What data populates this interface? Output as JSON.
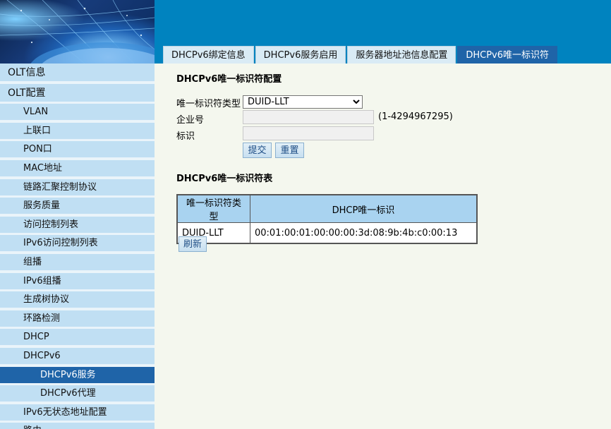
{
  "tabs": [
    {
      "label": "DHCPv6绑定信息",
      "active": false
    },
    {
      "label": "DHCPv6服务启用",
      "active": false
    },
    {
      "label": "服务器地址池信息配置",
      "active": false
    },
    {
      "label": "DHCPv6唯一标识符",
      "active": true
    }
  ],
  "sidebar": {
    "items": [
      {
        "label": "OLT信息",
        "level": 1
      },
      {
        "label": "OLT配置",
        "level": 1
      },
      {
        "label": "VLAN",
        "level": 2
      },
      {
        "label": "上联口",
        "level": 2
      },
      {
        "label": "PON口",
        "level": 2
      },
      {
        "label": "MAC地址",
        "level": 2
      },
      {
        "label": "链路汇聚控制协议",
        "level": 2
      },
      {
        "label": "服务质量",
        "level": 2
      },
      {
        "label": "访问控制列表",
        "level": 2
      },
      {
        "label": "IPv6访问控制列表",
        "level": 2
      },
      {
        "label": "组播",
        "level": 2
      },
      {
        "label": "IPv6组播",
        "level": 2
      },
      {
        "label": "生成树协议",
        "level": 2
      },
      {
        "label": "环路检测",
        "level": 2
      },
      {
        "label": "DHCP",
        "level": 2
      },
      {
        "label": "DHCPv6",
        "level": 2
      },
      {
        "label": "DHCPv6服务",
        "level": 3,
        "active": true
      },
      {
        "label": "DHCPv6代理",
        "level": 3
      },
      {
        "label": "IPv6无状态地址配置",
        "level": 2
      },
      {
        "label": "路由",
        "level": 2
      }
    ]
  },
  "config": {
    "title": "DHCPv6唯一标识符配置",
    "type_label": "唯一标识符类型",
    "type_value": "DUID-LLT",
    "enterprise_label": "企业号",
    "enterprise_value": "",
    "enterprise_hint": "(1-4294967295)",
    "id_label": "标识",
    "id_value": "",
    "submit_label": "提交",
    "reset_label": "重置"
  },
  "table": {
    "title": "DHCPv6唯一标识符表",
    "headers": [
      "唯一标识符类型",
      "DHCP唯一标识"
    ],
    "rows": [
      [
        "DUID-LLT",
        "00:01:00:01:00:00:00:3d:08:9b:4b:c0:00:13"
      ]
    ],
    "refresh_label": "刷新"
  }
}
